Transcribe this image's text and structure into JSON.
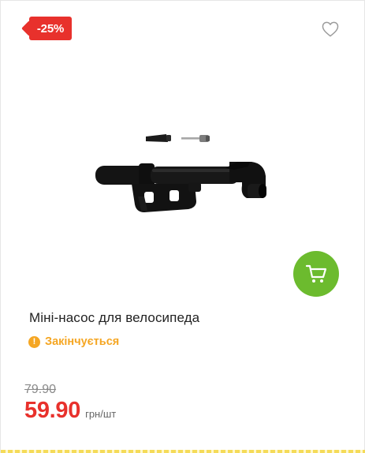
{
  "badge": {
    "discount": "-25%"
  },
  "icons": {
    "wishlist": "heart-outline-icon",
    "cart": "shopping-cart-icon",
    "warning": "exclamation-circle-icon"
  },
  "product": {
    "title": "Міні-насос для велосипеда",
    "stock_status": "Закінчується",
    "warning_glyph": "!",
    "old_price": "79.90",
    "price": "59.90",
    "unit": "грн/шт"
  },
  "colors": {
    "badge": "#e8312c",
    "price": "#e8312c",
    "cart_button": "#6cbb2e",
    "stock_warning": "#f5a623"
  }
}
